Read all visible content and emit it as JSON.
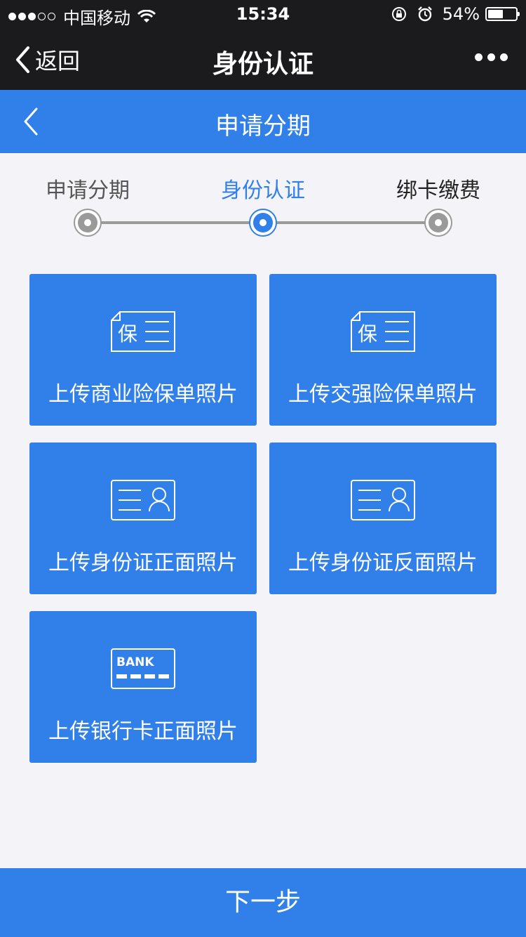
{
  "status_bar": {
    "carrier": "中国移动",
    "time": "15:34",
    "battery": "54%",
    "battery_level": 0.54,
    "icons": [
      "signal-icon",
      "wifi-icon",
      "rotation-lock-icon",
      "alarm-icon",
      "battery-icon"
    ]
  },
  "nav": {
    "back_label": "返回",
    "title": "身份认证",
    "more_icon": "more-dots-icon"
  },
  "header": {
    "title": "申请分期",
    "back_icon": "chevron-left-icon"
  },
  "steps": [
    {
      "label": "申请分期",
      "state": "done"
    },
    {
      "label": "身份认证",
      "state": "active"
    },
    {
      "label": "绑卡缴费",
      "state": "pending"
    }
  ],
  "colors": {
    "accent": "#3180ea",
    "bar": "#1b1b1e",
    "background": "#f3f3f8",
    "step_inactive": "#9a9a9a"
  },
  "upload_tiles": [
    {
      "label": "上传商业险保单照片",
      "icon": "insurance-document-icon",
      "icon_text": "保"
    },
    {
      "label": "上传交强险保单照片",
      "icon": "insurance-document-icon",
      "icon_text": "保"
    },
    {
      "label": "上传身份证正面照片",
      "icon": "id-card-icon"
    },
    {
      "label": "上传身份证反面照片",
      "icon": "id-card-icon"
    },
    {
      "label": "上传银行卡正面照片",
      "icon": "bank-card-icon",
      "icon_text": "BANK"
    }
  ],
  "next_button": "下一步"
}
